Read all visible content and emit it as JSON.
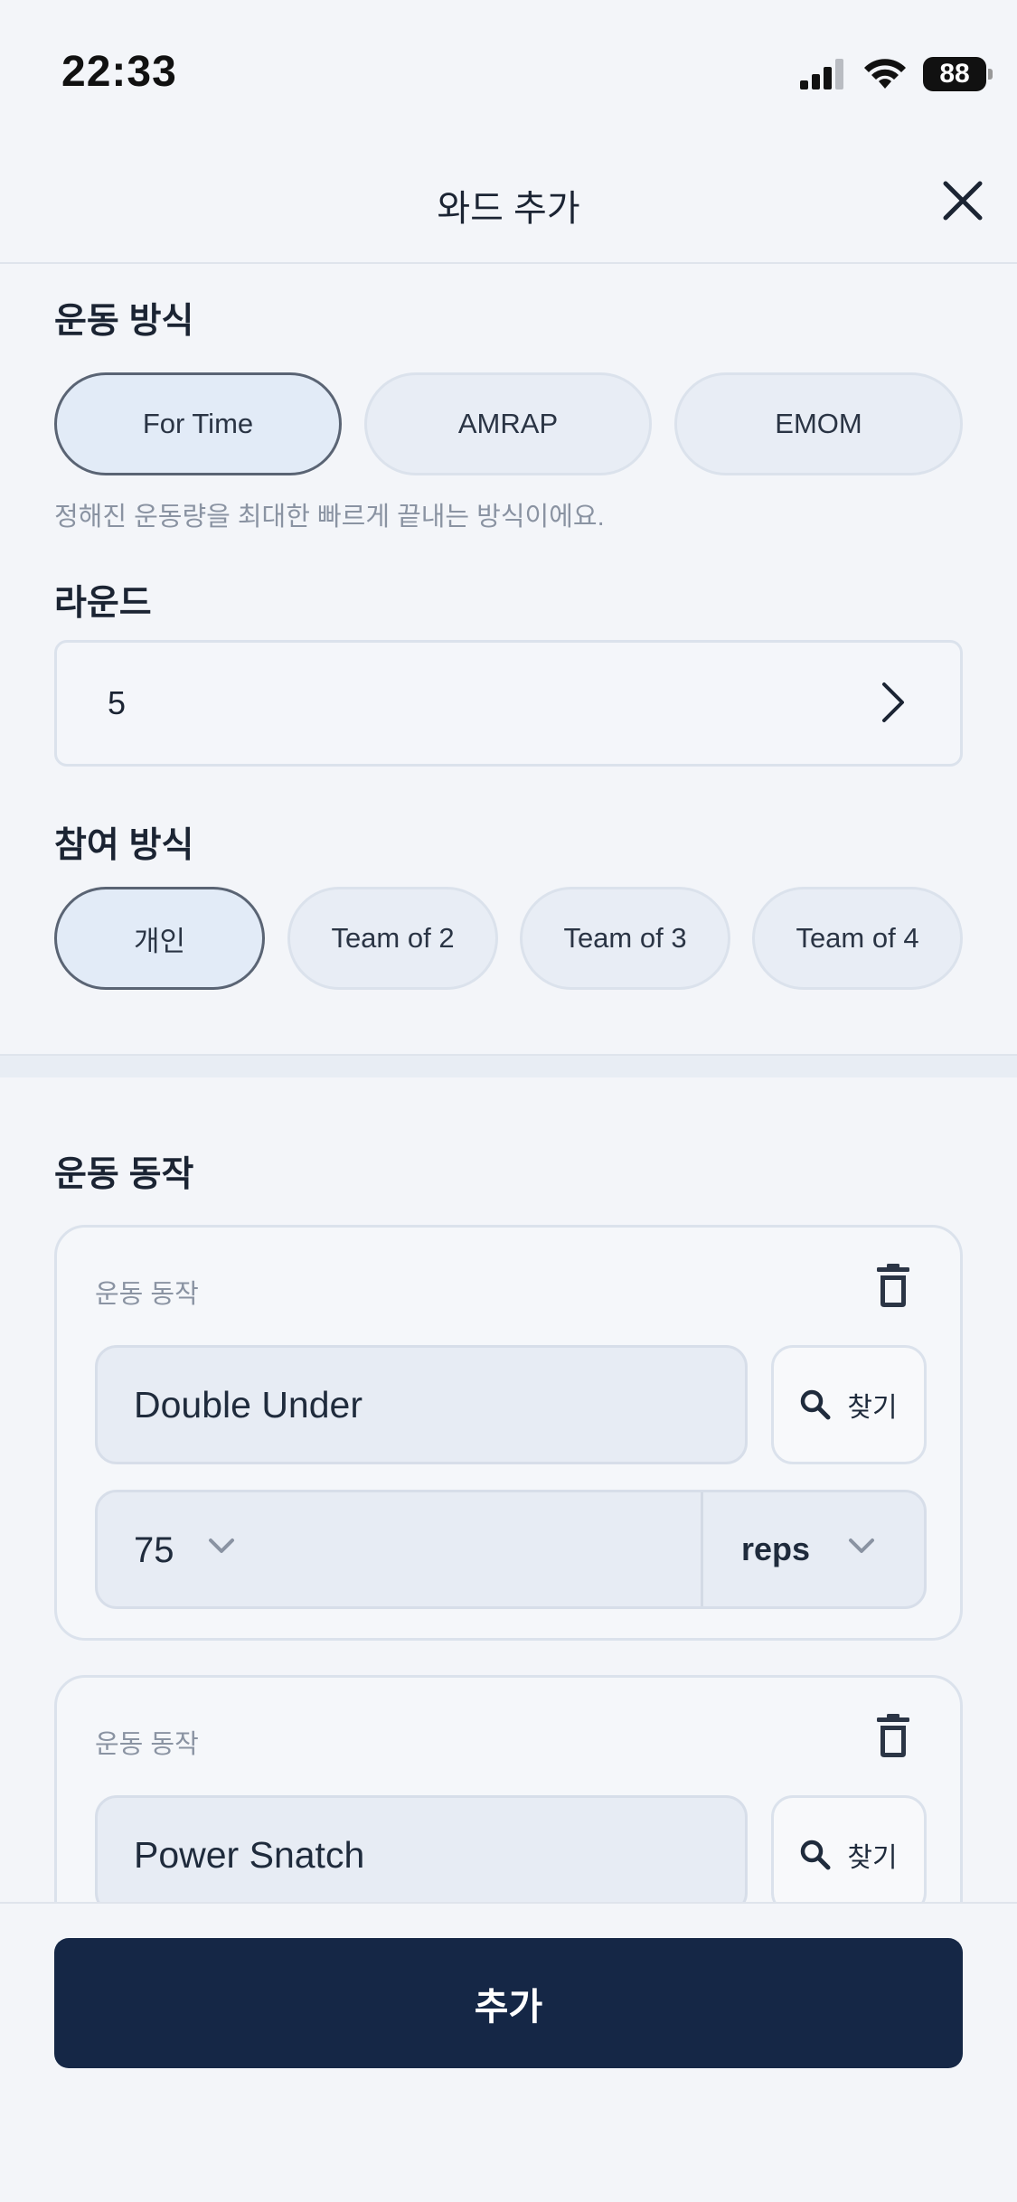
{
  "status_bar": {
    "time": "22:33",
    "battery": "88"
  },
  "header": {
    "title": "와드 추가"
  },
  "workout_type": {
    "title": "운동 방식",
    "options": [
      "For Time",
      "AMRAP",
      "EMOM"
    ],
    "selected": "For Time",
    "hint": "정해진 운동량을 최대한 빠르게 끝내는 방식이에요."
  },
  "rounds": {
    "title": "라운드",
    "value": "5"
  },
  "participation": {
    "title": "참여 방식",
    "options": [
      "개인",
      "Team of 2",
      "Team of 3",
      "Team of 4"
    ],
    "selected": "개인"
  },
  "movements": {
    "title": "운동 동작",
    "cards": [
      {
        "label": "운동 동작",
        "name": "Double Under",
        "find_label": "찾기",
        "quantity": "75",
        "unit": "reps"
      },
      {
        "label": "운동 동작",
        "name": "Power Snatch",
        "find_label": "찾기"
      }
    ]
  },
  "footer": {
    "submit_label": "추가"
  }
}
